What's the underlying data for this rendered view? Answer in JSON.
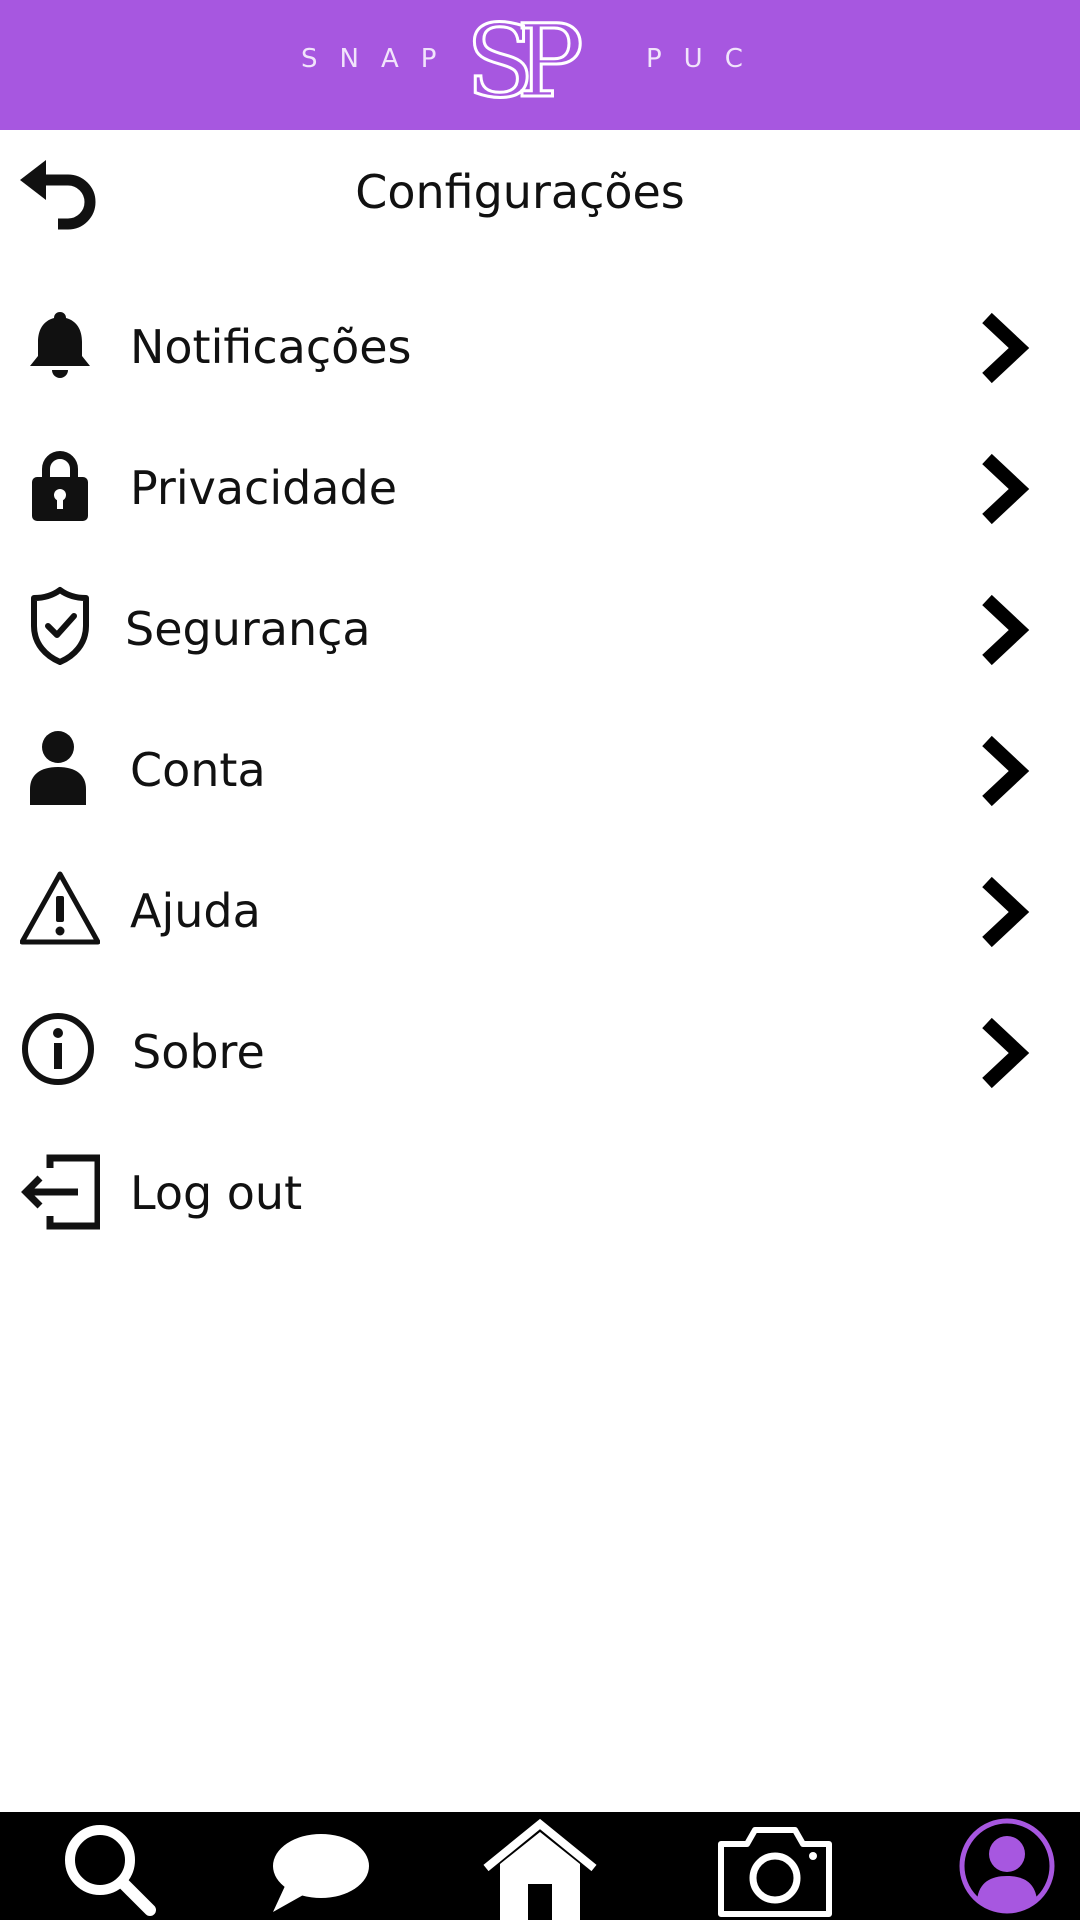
{
  "header": {
    "brand_left": "SNAP",
    "brand_right": "PUC",
    "logo_text": "SP",
    "background": "#a757e0"
  },
  "title": "Configurações",
  "menu": [
    {
      "label": "Notificações",
      "icon": "bell-icon",
      "chevron": true
    },
    {
      "label": "Privacidade",
      "icon": "lock-icon",
      "chevron": true
    },
    {
      "label": "Segurança",
      "icon": "shield-check-icon",
      "chevron": true
    },
    {
      "label": "Conta",
      "icon": "person-icon",
      "chevron": true
    },
    {
      "label": "Ajuda",
      "icon": "warning-icon",
      "chevron": true
    },
    {
      "label": "Sobre",
      "icon": "info-icon",
      "chevron": true
    },
    {
      "label": "Log out",
      "icon": "logout-icon",
      "chevron": false
    }
  ],
  "bottom_nav": {
    "items": [
      "search-icon",
      "chat-icon",
      "home-icon",
      "camera-icon",
      "profile-icon"
    ],
    "active": "profile-icon",
    "accent": "#a757e0"
  }
}
